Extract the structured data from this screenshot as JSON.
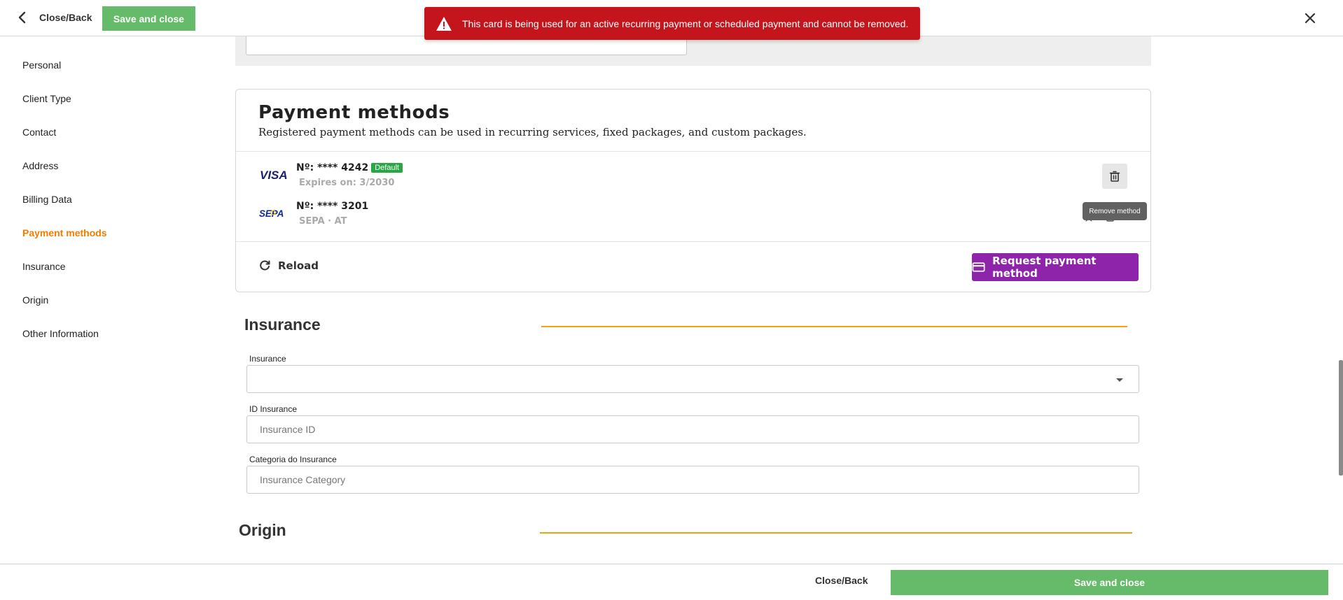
{
  "topbar": {
    "back_label": "Close/Back",
    "save_label": "Save and close"
  },
  "toast": {
    "message": "This card is being used for an active recurring payment or scheduled payment and cannot be removed."
  },
  "sidebar": {
    "items": [
      {
        "label": "Personal"
      },
      {
        "label": "Client Type"
      },
      {
        "label": "Contact"
      },
      {
        "label": "Address"
      },
      {
        "label": "Billing Data"
      },
      {
        "label": "Payment methods",
        "active": true
      },
      {
        "label": "Insurance"
      },
      {
        "label": "Origin"
      },
      {
        "label": "Other Information"
      }
    ]
  },
  "payment_methods": {
    "title": "Payment methods",
    "subtitle": "Registered payment methods can be used in recurring services, fixed packages, and custom packages.",
    "methods": [
      {
        "brand": "VISA",
        "number": "Nº: **** 4242",
        "badge": "Default",
        "detail": "Expires on: 3/2030"
      },
      {
        "brand": "SEPA",
        "number": "Nº: **** 3201",
        "detail": "SEPA · AT"
      }
    ],
    "tooltip": "Remove method",
    "reload_label": "Reload",
    "request_label": "Request payment method"
  },
  "insurance": {
    "title": "Insurance",
    "fields": [
      {
        "label": "Insurance",
        "placeholder": ""
      },
      {
        "label": "ID Insurance",
        "placeholder": "Insurance ID"
      },
      {
        "label": "Categoria do Insurance",
        "placeholder": "Insurance Category"
      }
    ]
  },
  "origin": {
    "title": "Origin"
  },
  "footer": {
    "back_label": "Close/Back",
    "save_label": "Save and close"
  },
  "colors": {
    "accent_orange": "#f57c00",
    "section_line": "#f2a20c",
    "save_green": "#66bb6a",
    "request_purple": "#8e24aa",
    "toast_red": "#c4141c",
    "badge_green": "#27a844"
  }
}
